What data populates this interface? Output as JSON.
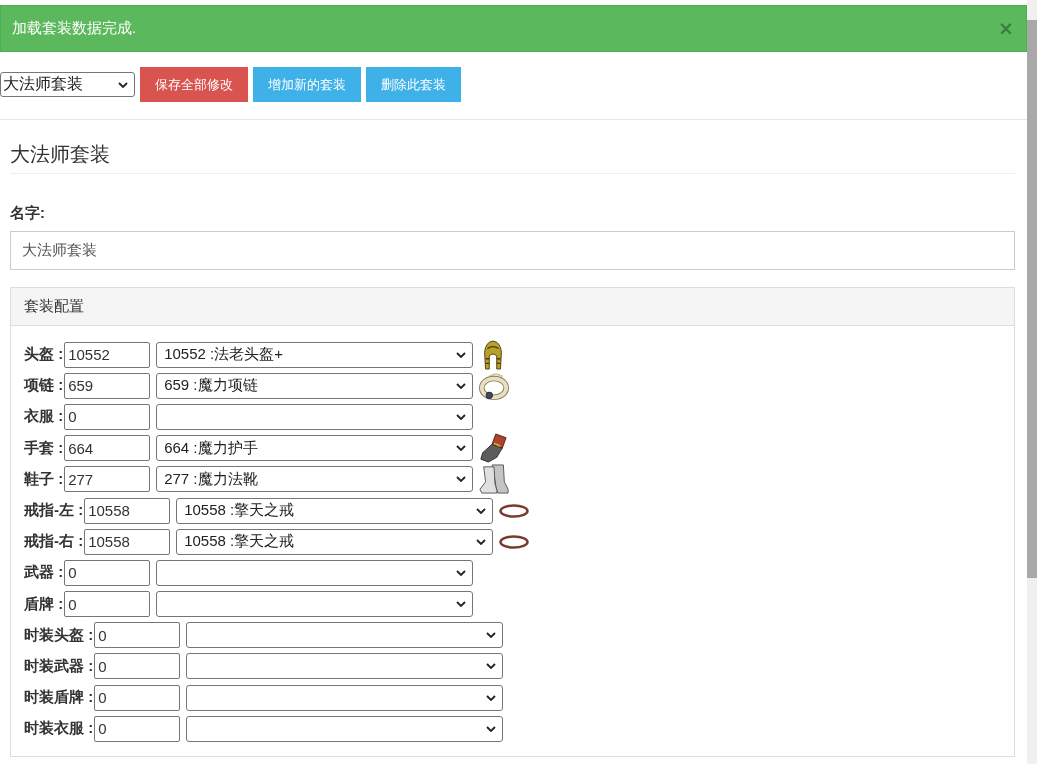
{
  "alert": {
    "message": "加载套装数据完成.",
    "close": "×"
  },
  "toolbar": {
    "set_select": {
      "value": "大法师套装"
    },
    "buttons": [
      {
        "kind": "danger",
        "label": "保存全部修改"
      },
      {
        "kind": "info",
        "label": "增加新的套装"
      },
      {
        "kind": "info",
        "label": "删除此套装"
      }
    ]
  },
  "set_title": "大法师套装",
  "name_field": {
    "label": "名字:",
    "value": "大法师套装"
  },
  "config_panel": {
    "title": "套装配置",
    "slots": [
      {
        "kind": "helmet",
        "label": "头盔 :",
        "id": "10552",
        "item": "10552 :法老头盔+"
      },
      {
        "kind": "necklace",
        "label": "项链 :",
        "id": "659",
        "item": "659 :魔力项链"
      },
      {
        "kind": "plain",
        "label": "衣服 :",
        "id": "0"
      },
      {
        "kind": "gloves",
        "label": "手套 :",
        "id": "664",
        "item": "664 :魔力护手"
      },
      {
        "kind": "boots",
        "label": "鞋子 :",
        "id": "277",
        "item": "277 :魔力法靴"
      },
      {
        "kind": "ring",
        "label": "戒指-左 :",
        "id": "10558",
        "item": "10558 :擎天之戒"
      },
      {
        "kind": "ring",
        "label": "戒指-右 :",
        "id": "10558",
        "item": "10558 :擎天之戒"
      },
      {
        "kind": "plain",
        "label": "武器 :",
        "id": "0"
      },
      {
        "kind": "plain",
        "label": "盾牌 :",
        "id": "0"
      },
      {
        "kind": "plain",
        "label": "时装头盔 :",
        "id": "0"
      },
      {
        "kind": "plain",
        "label": "时装武器 :",
        "id": "0"
      },
      {
        "kind": "plain",
        "label": "时装盾牌 :",
        "id": "0"
      },
      {
        "kind": "plain",
        "label": "时装衣服 :",
        "id": "0"
      }
    ]
  }
}
